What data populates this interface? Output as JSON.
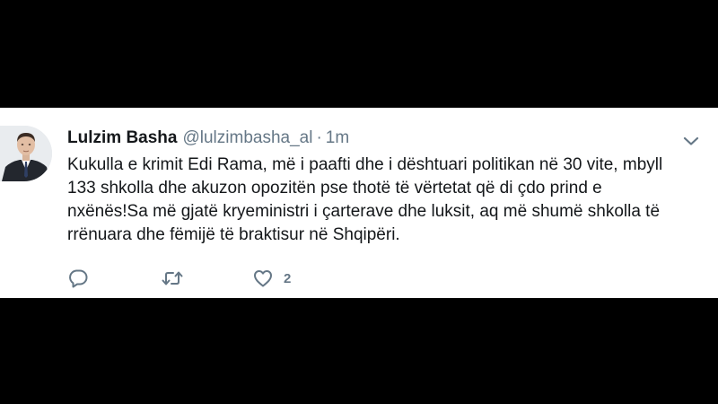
{
  "tweet": {
    "author_name": "Lulzim Basha",
    "author_handle": "@lulzimbasha_al",
    "separator": "·",
    "timestamp": "1m",
    "text": "Kukulla e krimit Edi Rama, më i paafti dhe i dështuari politikan në 30 vite, mbyll 133 shkolla dhe akuzon opozitën pse thotë të vërtetat që di çdo prind e nxënës!Sa më gjatë kryeministri i çarterave dhe luksit, aq më shumë shkolla të rrënuara dhe fëmijë të braktisur në Shqipëri.",
    "like_count": "2"
  },
  "icons": {
    "menu": "chevron-down-icon",
    "reply": "reply-bubble-icon",
    "retweet": "retweet-icon",
    "like": "heart-icon"
  },
  "colors": {
    "background": "#000000",
    "card": "#ffffff",
    "text": "#14171a",
    "secondary": "#657786",
    "icon": "#657786"
  }
}
